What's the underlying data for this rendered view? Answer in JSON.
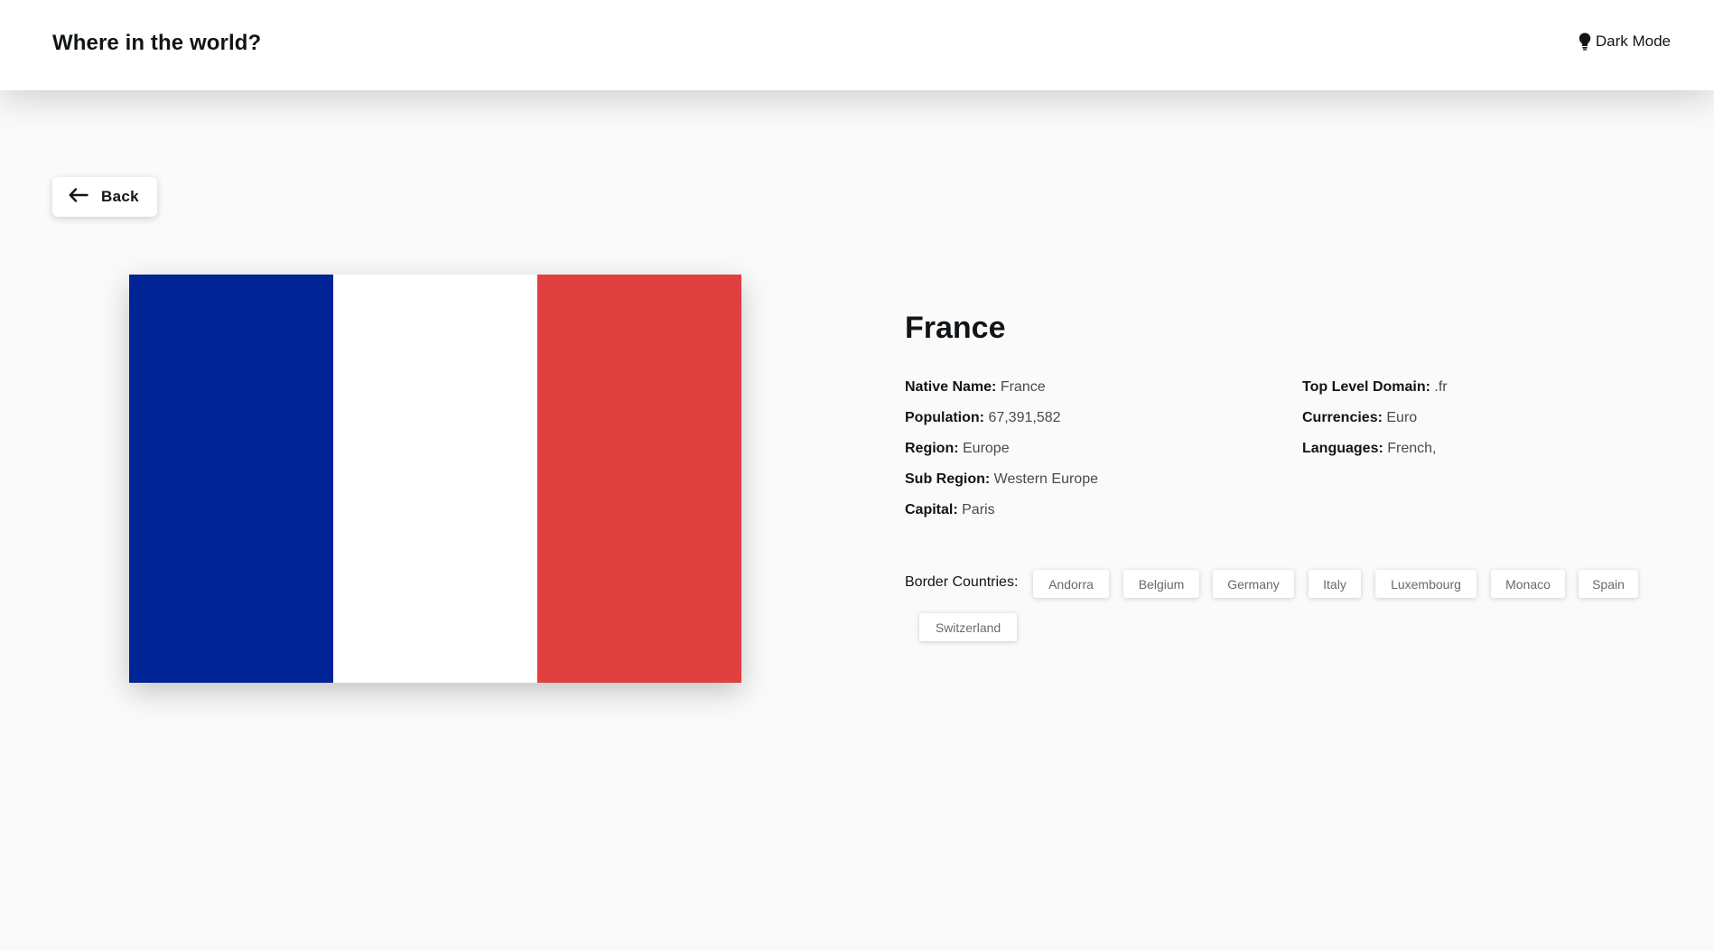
{
  "header": {
    "title": "Where in the world?",
    "theme_toggle_label": "Dark Mode",
    "theme_toggle_icon": "lightbulb-icon"
  },
  "back_button": {
    "label": "Back",
    "icon": "arrow-left-icon"
  },
  "flag": {
    "colors": [
      "#002395",
      "#ffffff",
      "#e04040"
    ]
  },
  "country": {
    "name": "France",
    "left_details": [
      {
        "label": "Native Name:",
        "value": "France"
      },
      {
        "label": "Population:",
        "value": "67,391,582"
      },
      {
        "label": "Region:",
        "value": "Europe"
      },
      {
        "label": "Sub Region:",
        "value": "Western Europe"
      },
      {
        "label": "Capital:",
        "value": "Paris"
      }
    ],
    "right_details": [
      {
        "label": "Top Level Domain:",
        "value": ".fr"
      },
      {
        "label": "Currencies:",
        "value": "Euro"
      },
      {
        "label": "Languages:",
        "value": "French,"
      }
    ],
    "border_label": "Border Countries:",
    "borders": [
      "Andorra",
      "Belgium",
      "Germany",
      "Italy",
      "Luxembourg",
      "Monaco",
      "Spain",
      "Switzerland"
    ]
  }
}
